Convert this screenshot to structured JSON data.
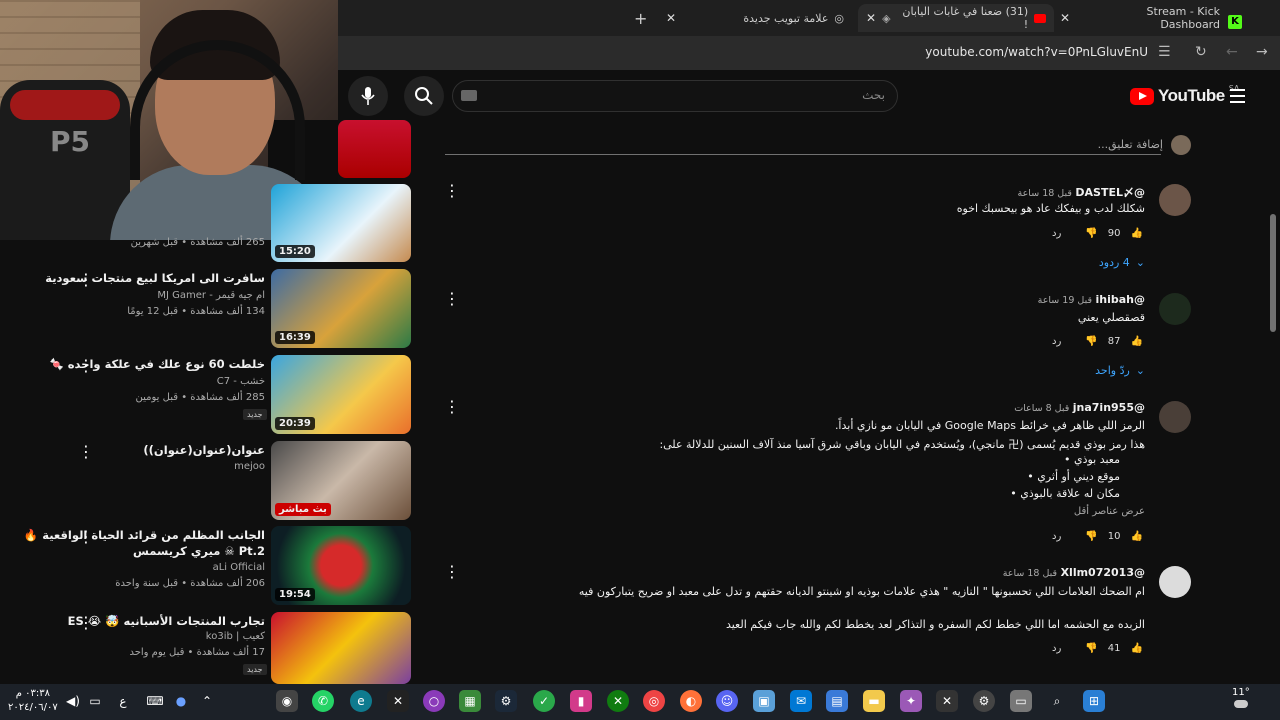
{
  "browser": {
    "tabs": [
      {
        "label": "Stream - Kick Dashboard"
      },
      {
        "label": "(31) ضعنا في غابات اليابان !"
      },
      {
        "label": "علامة تبويب جديدة"
      }
    ],
    "url": "youtube.com/watch?v=0PnLGluvEnU"
  },
  "youtube": {
    "logo_text": "YouTube",
    "country_code": "SA",
    "search_placeholder": "بحث",
    "add_comment": "إضافة تعليق..."
  },
  "sidebar_videos": [
    {
      "title": "",
      "channel": "",
      "meta": "265 ألف مشاهدة • قبل شهرين",
      "duration": "15:20",
      "badge": ""
    },
    {
      "title": "سافرت الى امريكا لبيع منتجات سعودية",
      "channel": "ام جيه قيمر - MJ Gamer",
      "meta": "134 ألف مشاهدة • قبل 12 يومًا",
      "duration": "16:39",
      "badge": ""
    },
    {
      "title": "خلطت 60 نوع علك في علكة واحده 🍬",
      "channel": "خشب - C7",
      "meta": "285 ألف مشاهدة • قبل يومين",
      "duration": "20:39",
      "badge": "جديد"
    },
    {
      "title": "عنوان(عنوان(عنوان))",
      "channel": "mejoo",
      "meta": "",
      "duration": "بث مباشر",
      "badge": ""
    },
    {
      "title": "الجانب المظلم من قرائد الحياة الواقعية 🔥",
      "title2": "Pt.2 ☠ ميري كريسمس",
      "channel": "aLi Official",
      "meta": "206 ألف مشاهدة • قبل سنة واحدة",
      "duration": "19:54",
      "badge": ""
    },
    {
      "title": "تجارب المنتجات الأسبانيه 🤯 😭 ES",
      "channel": "كعيب | ko3ib",
      "meta": "17 ألف مشاهدة • قبل يوم واحد",
      "duration": "",
      "badge": "جديد"
    }
  ],
  "comments": [
    {
      "user": "@DASTEL〆",
      "time": "قبل 18 ساعة",
      "lines": [
        "شكلك لدب و بيفكك عاد هو بيحسبك اخوه"
      ],
      "likes": "90",
      "reply": "رد",
      "replies": "4 ردود"
    },
    {
      "user": "@ihibah",
      "time": "قبل 19 ساعة",
      "lines": [
        "قصقصلي يعني"
      ],
      "likes": "87",
      "reply": "رد",
      "replies": "ردّ واحد"
    },
    {
      "user": "@jna7in955",
      "time": "قبل 8 ساعات",
      "lines": [
        "الرمز اللي ظاهر في خرائط Google Maps في اليابان مو نازي أبداً.",
        "هذا رمز بوذي قديم يُسمى (卍 مانجي)، ويُستخدم في اليابان وباقي شرق آسيا منذ آلاف السنين للدلالة على:"
      ],
      "bullets": [
        "معبد بوذي",
        "موقع ديني أو أثري",
        "مكان له علاقة بالبوذي"
      ],
      "show_less": "عرض عناصر أقل",
      "likes": "10",
      "reply": "رد"
    },
    {
      "user": "@Xllm072013",
      "time": "قبل 18 ساعة",
      "lines": [
        "ام الضحك العلامات اللي تحسبونها \" النازيه \" هذي علامات بوذيه او شينتو الديانه حقتهم و تدل على معبد او ضريح يتباركون فيه",
        "",
        "الزبده مع الحشمه اما اللي خطط لكم السفره و التذاكر لعد يخطط لكم والله جاب فيكم العيد"
      ],
      "likes": "41",
      "reply": "رد"
    }
  ],
  "taskbar": {
    "time": "٠٣:٣٨ م",
    "date": "٢٠٢٤/٠٦/٠٧",
    "lang": "ع",
    "temp": "11°"
  },
  "colors": {
    "accent": "#3ea6ff",
    "brand_red": "#ff0000"
  }
}
